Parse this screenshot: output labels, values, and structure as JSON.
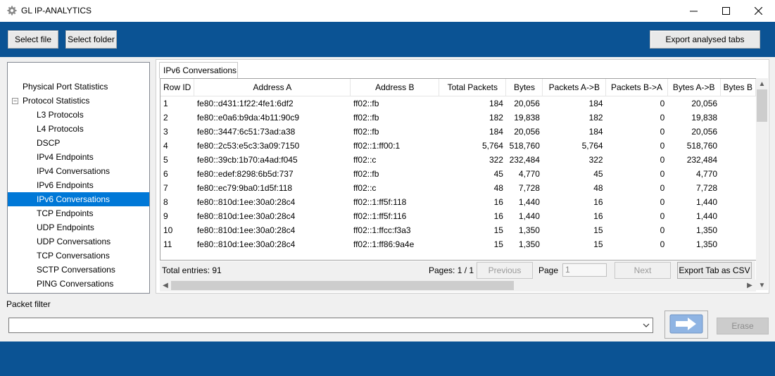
{
  "window": {
    "title": "GL IP-ANALYTICS",
    "icon": "gear-icon",
    "controls": [
      "minimize-icon",
      "maximize-icon",
      "close-icon"
    ]
  },
  "toolbar": {
    "select_file": "Select file",
    "select_folder": "Select folder",
    "export_tabs": "Export analysed tabs"
  },
  "tree": {
    "items": [
      {
        "label": "Physical Port Statistics",
        "level": 0,
        "selected": false
      },
      {
        "label": "Protocol Statistics",
        "level": 0,
        "selected": false,
        "expanded": true
      },
      {
        "label": "L3 Protocols",
        "level": 1,
        "selected": false
      },
      {
        "label": "L4 Protocols",
        "level": 1,
        "selected": false
      },
      {
        "label": "DSCP",
        "level": 1,
        "selected": false
      },
      {
        "label": "IPv4 Endpoints",
        "level": 1,
        "selected": false
      },
      {
        "label": "IPv4 Conversations",
        "level": 1,
        "selected": false
      },
      {
        "label": "IPv6 Endpoints",
        "level": 1,
        "selected": false
      },
      {
        "label": "IPv6 Conversations",
        "level": 1,
        "selected": true
      },
      {
        "label": "TCP Endpoints",
        "level": 1,
        "selected": false
      },
      {
        "label": "UDP Endpoints",
        "level": 1,
        "selected": false
      },
      {
        "label": "UDP Conversations",
        "level": 1,
        "selected": false
      },
      {
        "label": "TCP Conversations",
        "level": 1,
        "selected": false
      },
      {
        "label": "SCTP Conversations",
        "level": 1,
        "selected": false
      },
      {
        "label": "PING Conversations",
        "level": 1,
        "selected": false
      }
    ]
  },
  "tab": {
    "label": "IPv6 Conversations"
  },
  "table": {
    "columns": [
      "Row ID",
      "Address A",
      "Address B",
      "Total Packets",
      "Bytes",
      "Packets A->B",
      "Packets B->A",
      "Bytes A->B",
      "Bytes B"
    ],
    "rows": [
      [
        "1",
        "fe80::d431:1f22:4fe1:6df2",
        "ff02::fb",
        "184",
        "20,056",
        "184",
        "0",
        "20,056"
      ],
      [
        "2",
        "fe80::e0a6:b9da:4b11:90c9",
        "ff02::fb",
        "182",
        "19,838",
        "182",
        "0",
        "19,838"
      ],
      [
        "3",
        "fe80::3447:6c51:73ad:a38",
        "ff02::fb",
        "184",
        "20,056",
        "184",
        "0",
        "20,056"
      ],
      [
        "4",
        "fe80::2c53:e5c3:3a09:7150",
        "ff02::1:ff00:1",
        "5,764",
        "518,760",
        "5,764",
        "0",
        "518,760"
      ],
      [
        "5",
        "fe80::39cb:1b70:a4ad:f045",
        "ff02::c",
        "322",
        "232,484",
        "322",
        "0",
        "232,484"
      ],
      [
        "6",
        "fe80::edef:8298:6b5d:737",
        "ff02::fb",
        "45",
        "4,770",
        "45",
        "0",
        "4,770"
      ],
      [
        "7",
        "fe80::ec79:9ba0:1d5f:118",
        "ff02::c",
        "48",
        "7,728",
        "48",
        "0",
        "7,728"
      ],
      [
        "8",
        "fe80::810d:1ee:30a0:28c4",
        "ff02::1:ff5f:118",
        "16",
        "1,440",
        "16",
        "0",
        "1,440"
      ],
      [
        "9",
        "fe80::810d:1ee:30a0:28c4",
        "ff02::1:ff5f:116",
        "16",
        "1,440",
        "16",
        "0",
        "1,440"
      ],
      [
        "10",
        "fe80::810d:1ee:30a0:28c4",
        "ff02::1:ffcc:f3a3",
        "15",
        "1,350",
        "15",
        "0",
        "1,350"
      ],
      [
        "11",
        "fe80::810d:1ee:30a0:28c4",
        "ff02::1:ff86:9a4e",
        "15",
        "1,350",
        "15",
        "0",
        "1,350"
      ]
    ]
  },
  "pager": {
    "total_entries": "Total entries: 91",
    "pages": "Pages: 1 / 1",
    "previous": "Previous",
    "page_label": "Page",
    "page_value": "1",
    "next": "Next",
    "export_csv": "Export Tab as CSV"
  },
  "filter": {
    "label": "Packet filter",
    "value": "",
    "erase": "Erase",
    "apply_icon": "arrow-right-icon"
  },
  "colors": {
    "brand_blue": "#0b5394",
    "selection": "#0078d7"
  }
}
